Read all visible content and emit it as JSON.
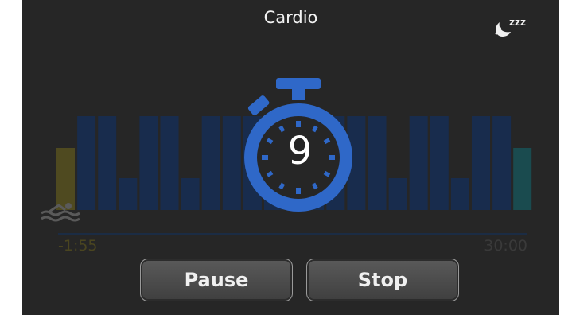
{
  "header": {
    "title": "Cardio",
    "sleep_icon": "moon-zzz-icon"
  },
  "timer": {
    "countdown": "9",
    "icon": "stopwatch-icon",
    "color": "#2f68c8"
  },
  "timeline": {
    "start_label": "-1:55",
    "end_label": "30:00",
    "activity_icon": "swim-icon"
  },
  "chart_data": {
    "type": "bar",
    "values": [
      2,
      3,
      3,
      1,
      3,
      3,
      1,
      3,
      3,
      3,
      3,
      1,
      3,
      3,
      3,
      3,
      1,
      3,
      3,
      1,
      3,
      3,
      2
    ],
    "colors": {
      "warmup": "#4f4a20",
      "interval": "#182c4d",
      "cooldown": "#1a4b4f"
    }
  },
  "controls": {
    "pause_label": "Pause",
    "stop_label": "Stop"
  }
}
